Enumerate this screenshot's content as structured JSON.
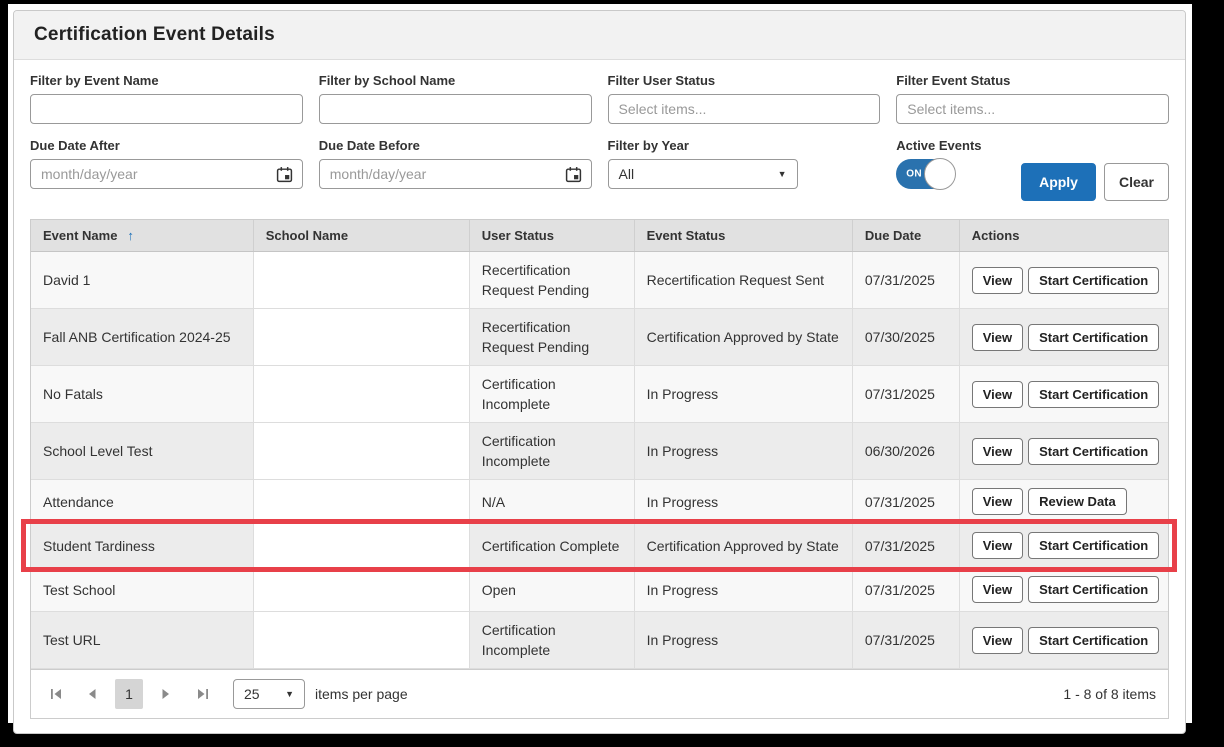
{
  "title": "Certification Event Details",
  "filters": {
    "event_name_label": "Filter by Event Name",
    "event_name_value": "",
    "school_name_label": "Filter by School Name",
    "school_name_value": "",
    "user_status_label": "Filter User Status",
    "user_status_placeholder": "Select items...",
    "event_status_label": "Filter Event Status",
    "event_status_placeholder": "Select items...",
    "due_date_after_label": "Due Date After",
    "due_date_before_label": "Due Date Before",
    "date_placeholder": "month/day/year",
    "year_label": "Filter by Year",
    "year_value": "All",
    "active_events_label": "Active Events",
    "toggle_state": "ON",
    "apply_label": "Apply",
    "clear_label": "Clear"
  },
  "table": {
    "headers": {
      "event_name": "Event Name",
      "school_name": "School Name",
      "user_status": "User Status",
      "event_status": "Event Status",
      "due_date": "Due Date",
      "actions": "Actions"
    },
    "sort": {
      "column": "Event Name",
      "direction": "ascending",
      "icon": "↑"
    },
    "rows": [
      {
        "event_name": "David 1",
        "school_name": "",
        "user_status": "Recertification Request Pending",
        "event_status": "Recertification Request Sent",
        "due_date": "07/31/2025",
        "actions": [
          "View",
          "Start Certification"
        ]
      },
      {
        "event_name": "Fall ANB Certification 2024-25",
        "school_name": "",
        "user_status": "Recertification Request Pending",
        "event_status": "Certification Approved by State",
        "due_date": "07/30/2025",
        "actions": [
          "View",
          "Start Certification"
        ]
      },
      {
        "event_name": "No Fatals",
        "school_name": "",
        "user_status": "Certification Incomplete",
        "event_status": "In Progress",
        "due_date": "07/31/2025",
        "actions": [
          "View",
          "Start Certification"
        ]
      },
      {
        "event_name": "School Level Test",
        "school_name": "",
        "user_status": "Certification Incomplete",
        "event_status": "In Progress",
        "due_date": "06/30/2026",
        "actions": [
          "View",
          "Start Certification"
        ]
      },
      {
        "event_name": "Attendance",
        "school_name": "",
        "user_status": "N/A",
        "event_status": "In Progress",
        "due_date": "07/31/2025",
        "actions": [
          "View",
          "Review Data"
        ]
      },
      {
        "event_name": "Student Tardiness",
        "school_name": "",
        "user_status": "Certification Complete",
        "event_status": "Certification Approved by State",
        "due_date": "07/31/2025",
        "actions": [
          "View",
          "Start Certification"
        ],
        "highlighted": true
      },
      {
        "event_name": "Test School",
        "school_name": "",
        "user_status": "Open",
        "event_status": "In Progress",
        "due_date": "07/31/2025",
        "actions": [
          "View",
          "Start Certification"
        ]
      },
      {
        "event_name": "Test URL",
        "school_name": "",
        "user_status": "Certification Incomplete",
        "event_status": "In Progress",
        "due_date": "07/31/2025",
        "actions": [
          "View",
          "Start Certification"
        ]
      }
    ]
  },
  "pagination": {
    "current_page": "1",
    "page_size": "25",
    "items_per_page_label": "items per page",
    "range_label": "1 - 8 of 8 items"
  },
  "annotation": {
    "highlighted_row": "Student Tardiness",
    "color": "#e84049"
  },
  "colors": {
    "accent_blue": "#1d70b8",
    "toggle_blue": "#2a72ae",
    "header_gray": "#e1e1e1"
  }
}
